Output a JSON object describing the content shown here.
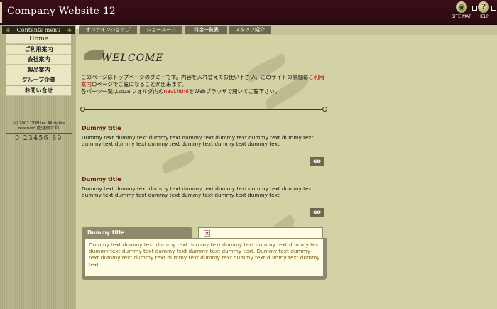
{
  "header": {
    "site_title": "Company Website 12",
    "sitemap_label": "SITE MAP",
    "help_label": "HELP"
  },
  "sidebar": {
    "menu_title": "Contents menu",
    "items": [
      {
        "label": "Home"
      },
      {
        "label": "ご利用案内"
      },
      {
        "label": "会社案内"
      },
      {
        "label": "製品案内"
      },
      {
        "label": "グループ企業"
      },
      {
        "label": "お問い合せ"
      }
    ],
    "copyright_line1": "(c) 2002 DDN.inc All rights",
    "copyright_line2": "reserved (記述例です)",
    "phone": "0 23456 89"
  },
  "topnav": {
    "tabs": [
      {
        "label": "オンラインショップ"
      },
      {
        "label": "ショールーム"
      },
      {
        "label": "料金一覧表"
      },
      {
        "label": "スタッフ紹介"
      }
    ]
  },
  "main": {
    "welcome": "WELCOME",
    "intro_part1": "このページはトップページのダミーです。内容を入れ替えてお使い下さい。このサイトの詳細は",
    "intro_link1": "ご利用案内",
    "intro_part2": "のページでご覧になることが出来ます。",
    "intro_part3": "各パーツ一覧はsozaiフォルダ内の",
    "intro_link2": "navi.html",
    "intro_part4": "をWebブラウザで開いてご覧下さい。",
    "sections": [
      {
        "title": "Dummy title",
        "body": "Dummy text dummy text dummy text dummy text dummy text dummy text dummy text dummy text dummy text dummy text dummy text dummy text dummy text.",
        "go": "GO"
      },
      {
        "title": "Dummy title",
        "body": "Dummy text dummy text dummy text dummy text dummy text dummy text dummy text dummy text dummy text dummy text dummy text dummy text dummy text.",
        "go": "GO"
      }
    ],
    "box": {
      "title": "Dummy title",
      "body": "Dummy text dummy text dummy text dummy text dummy text dummy text dummy text dummy text dummy text dummy text dummy text dummy text. Dummy text dummy text dummy text dummy text dummy text dummy text dummy text dummy text dummy text."
    }
  }
}
